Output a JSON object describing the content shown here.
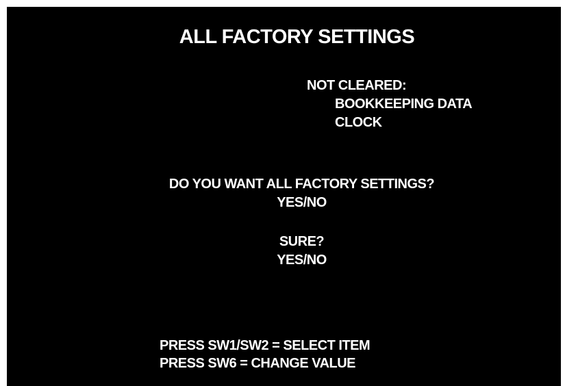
{
  "screen": {
    "title": "ALL FACTORY SETTINGS",
    "not_cleared": {
      "heading": "NOT CLEARED:",
      "items": [
        "BOOKKEEPING DATA",
        "CLOCK"
      ]
    },
    "question": {
      "prompt": "DO YOU WANT ALL FACTORY SETTINGS?",
      "options": "YES/NO"
    },
    "confirm": {
      "prompt": "SURE?",
      "options": "YES/NO"
    },
    "instructions": [
      "PRESS SW1/SW2 = SELECT ITEM",
      "PRESS SW6 = CHANGE VALUE"
    ],
    "colors": {
      "background": "#000000",
      "text": "#ffffff"
    }
  }
}
